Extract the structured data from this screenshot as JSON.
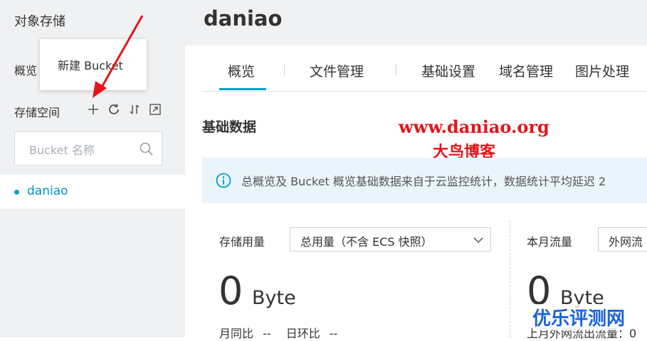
{
  "sidebar": {
    "title": "对象存储",
    "overview": "概览",
    "storage_space": "存储空间",
    "search_placeholder": "Bucket 名称",
    "buckets": [
      {
        "name": "daniao"
      }
    ],
    "tooltip": "新建 Bucket"
  },
  "header": {
    "title": "daniao"
  },
  "tabs": [
    {
      "label": "概览",
      "active": true
    },
    {
      "label": "文件管理"
    },
    {
      "label": "基础设置"
    },
    {
      "label": "域名管理"
    },
    {
      "label": "图片处理"
    }
  ],
  "section": {
    "title": "基础数据"
  },
  "notice": {
    "text": "总概览及 Bucket 概览基础数据来自于云监控统计，数据统计平均延迟 2"
  },
  "storage_card": {
    "label": "存储用量",
    "select_value": "总用量（不含 ECS 快照）",
    "value": "0",
    "unit": "Byte",
    "yoy_label": "月同比",
    "yoy_value": "--",
    "dod_label": "日环比",
    "dod_value": "--"
  },
  "traffic_card": {
    "label": "本月流量",
    "select_value": "外网流",
    "value": "0",
    "unit": "Byte",
    "last_month": "上月外网流出流量：0"
  },
  "watermarks": {
    "site_url": "www.daniao.org",
    "site_name": "大鸟博客",
    "corner": "优乐评测网"
  },
  "colors": {
    "accent": "#00a2ca",
    "sidebar_bg": "#eff1f3",
    "notice_bg": "#e9f5fb",
    "watermark_red": "#e5141b",
    "watermark_blue": "#1a63d8"
  }
}
